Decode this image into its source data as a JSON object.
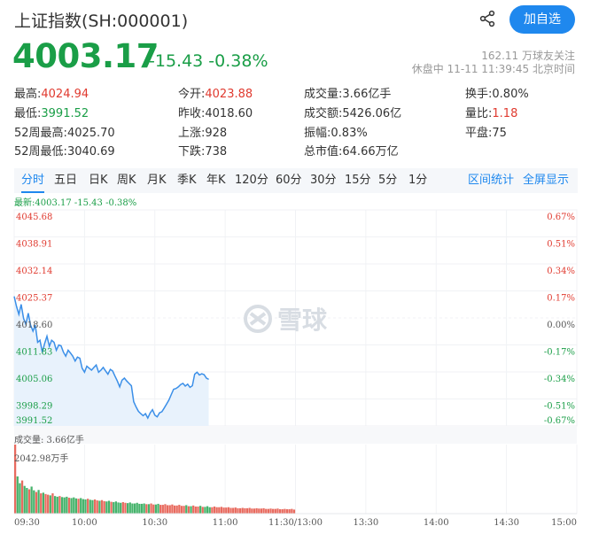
{
  "header": {
    "title": "上证指数(SH:000001)",
    "share_icon": "share-icon",
    "follow_label": "加自选"
  },
  "price": {
    "current": "4003.17",
    "change": "-15.43",
    "change_pct": "-0.38%",
    "followers": "162.11 万球友关注",
    "status": "休盘中 11-11 11:39:45 北京时间"
  },
  "quote": [
    [
      {
        "label": "最高:",
        "value": "4024.94",
        "color": "red"
      },
      {
        "label": "今开:",
        "value": "4023.88",
        "color": "red"
      },
      {
        "label": "成交量:",
        "value": "3.66亿手",
        "color": ""
      },
      {
        "label": "换手:",
        "value": "0.80%",
        "color": ""
      }
    ],
    [
      {
        "label": "最低:",
        "value": "3991.52",
        "color": "green"
      },
      {
        "label": "昨收:",
        "value": "4018.60",
        "color": ""
      },
      {
        "label": "成交额:",
        "value": "5426.06亿",
        "color": ""
      },
      {
        "label": "量比:",
        "value": "1.18",
        "color": "red"
      }
    ],
    [
      {
        "label": "52周最高:",
        "value": "4025.70",
        "color": ""
      },
      {
        "label": "上涨:",
        "value": "928",
        "color": ""
      },
      {
        "label": "振幅:",
        "value": "0.83%",
        "color": ""
      },
      {
        "label": "平盘:",
        "value": "75",
        "color": ""
      }
    ],
    [
      {
        "label": "52周最低:",
        "value": "3040.69",
        "color": ""
      },
      {
        "label": "下跌:",
        "value": "738",
        "color": ""
      },
      {
        "label": "总市值:",
        "value": "64.66万亿",
        "color": ""
      }
    ]
  ],
  "tabs": [
    "分时",
    "五日",
    "日K",
    "周K",
    "月K",
    "季K",
    "年K",
    "120分",
    "60分",
    "30分",
    "15分",
    "5分",
    "1分"
  ],
  "tab_links": [
    "区间统计",
    "全屏显示"
  ],
  "chart": {
    "latest": "最新:4003.17 -15.43 -0.38%",
    "watermark": "雪球",
    "volume_label": "成交量: 3.66亿手",
    "volume_max": "2042.98万手"
  },
  "chart_data": {
    "type": "line",
    "y_ticks": [
      "4045.68",
      "4038.91",
      "4032.14",
      "4025.37",
      "4018.60",
      "4011.83",
      "4005.06",
      "3998.29",
      "3991.52"
    ],
    "pct_ticks": [
      "0.67%",
      "0.51%",
      "0.34%",
      "0.17%",
      "0.00%",
      "-0.17%",
      "-0.34%",
      "-0.51%",
      "-0.67%"
    ],
    "x_ticks": [
      "09:30",
      "10:00",
      "10:30",
      "11:00",
      "11:30/13:00",
      "13:30",
      "14:00",
      "14:30",
      "15:00"
    ],
    "ylim": [
      3991.52,
      4045.68
    ],
    "prev_close": 4018.6,
    "minutes": 240,
    "price": [
      4024.0,
      4021.5,
      4019.5,
      4022.0,
      4018.5,
      4017.0,
      4019.8,
      4016.8,
      4015.3,
      4016.8,
      4012.5,
      4013.0,
      4010.0,
      4012.2,
      4014.0,
      4011.5,
      4013.0,
      4012.5,
      4010.5,
      4011.8,
      4011.6,
      4010.0,
      4009.0,
      4010.5,
      4009.8,
      4009.0,
      4007.8,
      4008.8,
      4008.5,
      4006.0,
      4005.0,
      4006.5,
      4006.0,
      4005.5,
      4006.2,
      4006.8,
      4005.0,
      4005.5,
      4006.2,
      4005.3,
      4004.5,
      4005.7,
      4005.3,
      4004.0,
      4002.8,
      4001.3,
      4003.0,
      4003.5,
      4002.8,
      4002.2,
      4001.6,
      3997.6,
      3996.3,
      3995.2,
      3994.6,
      3994.1,
      3994.6,
      3993.5,
      3994.8,
      3995.6,
      3994.2,
      3993.8,
      3994.8,
      3995.1,
      3996.0,
      3997.0,
      3998.0,
      3999.4,
      4000.7,
      4000.9,
      4001.3,
      4001.9,
      4002.2,
      4001.5,
      4002.0,
      4001.2,
      4001.6,
      4004.5,
      4005.0,
      4004.3,
      4004.6,
      4004.4,
      4003.5,
      4003.2
    ],
    "volume": [
      2042.98,
      1100,
      900,
      980,
      820,
      760,
      720,
      800,
      690,
      640,
      700,
      600,
      620,
      580,
      560,
      540,
      600,
      520,
      500,
      520,
      490,
      480,
      500,
      470,
      460,
      480,
      450,
      440,
      460,
      430,
      420,
      440,
      410,
      400,
      420,
      390,
      380,
      400,
      370,
      360,
      380,
      350,
      340,
      360,
      330,
      320,
      340,
      320,
      310,
      330,
      300,
      300,
      320,
      290,
      290,
      300,
      280,
      280,
      300,
      270,
      270,
      290,
      260,
      260,
      280,
      250,
      250,
      270,
      240,
      240,
      260,
      230,
      230,
      250,
      220,
      220,
      240,
      210,
      210,
      230,
      200,
      200,
      220,
      190,
      190,
      210,
      190,
      190,
      200,
      180,
      180,
      190,
      170,
      170,
      180,
      160,
      160,
      170,
      160,
      160,
      170,
      150,
      150,
      160,
      150,
      150,
      160,
      140,
      140,
      150,
      140,
      140,
      150,
      130,
      130,
      140,
      130,
      130,
      140,
      120
    ]
  }
}
